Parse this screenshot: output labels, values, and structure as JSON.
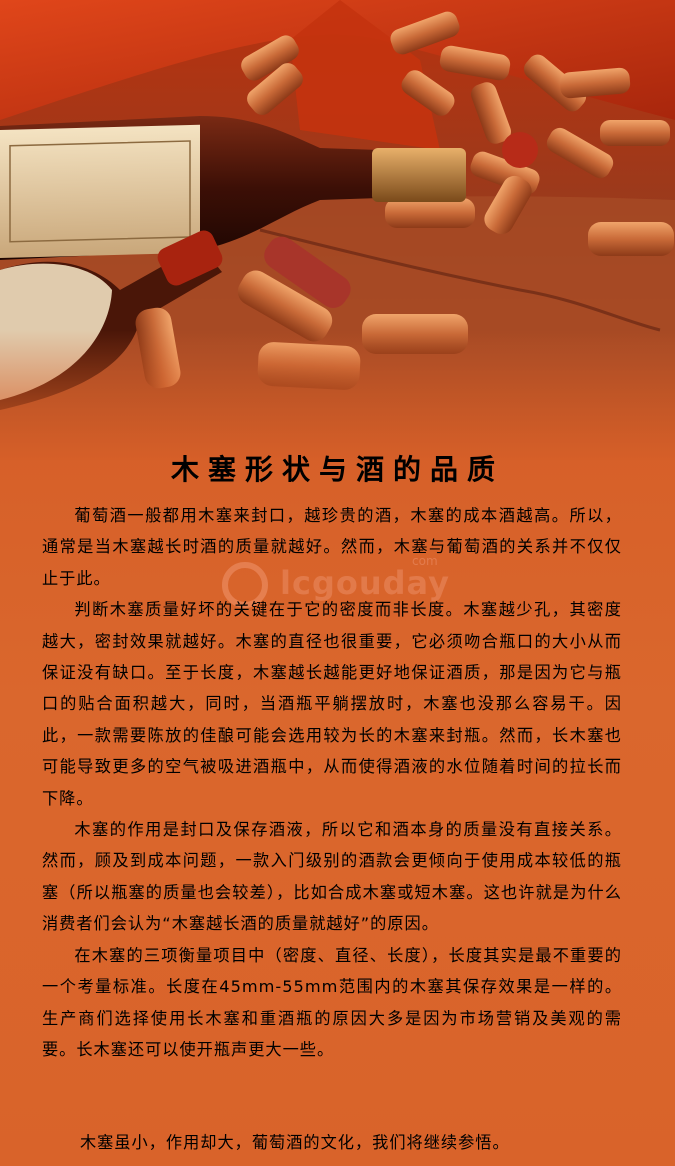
{
  "article": {
    "title": "木塞形状与酒的品质",
    "paragraphs": [
      "葡萄酒一般都用木塞来封口，越珍贵的酒，木塞的成本酒越高。所以，通常是当木塞越长时酒的质量就越好。然而，木塞与葡萄酒的关系并不仅仅止于此。",
      "判断木塞质量好坏的关键在于它的密度而非长度。木塞越少孔，其密度越大，密封效果就越好。木塞的直径也很重要，它必须吻合瓶口的大小从而保证没有缺口。至于长度，木塞越长越能更好地保证酒质，那是因为它与瓶口的贴合面积越大，同时，当酒瓶平躺摆放时，木塞也没那么容易干。因此，一款需要陈放的佳酿可能会选用较为长的木塞来封瓶。然而，长木塞也可能导致更多的空气被吸进酒瓶中，从而使得酒液的水位随着时间的拉长而下降。",
      "木塞的作用是封口及保存酒液，所以它和酒本身的质量没有直接关系。然而，顾及到成本问题，一款入门级别的酒款会更倾向于使用成本较低的瓶塞（所以瓶塞的质量也会较差），比如合成木塞或短木塞。这也许就是为什么消费者们会认为“木塞越长酒的质量就越好”的原因。",
      "在木塞的三项衡量项目中（密度、直径、长度），长度其实是最不重要的一个考量标准。长度在45mm-55mm范围内的木塞其保存效果是一样的。生产商们选择使用长木塞和重酒瓶的原因大多是因为市场营销及美观的需要。长木塞还可以使开瓶声更大一些。"
    ],
    "closing": "木塞虽小，作用却大，葡萄酒的文化，我们将继续参悟。"
  },
  "watermark": {
    "text": "lcgouday",
    "suffix": "com"
  },
  "colors": {
    "background": "#d9652c",
    "text": "#000000"
  }
}
